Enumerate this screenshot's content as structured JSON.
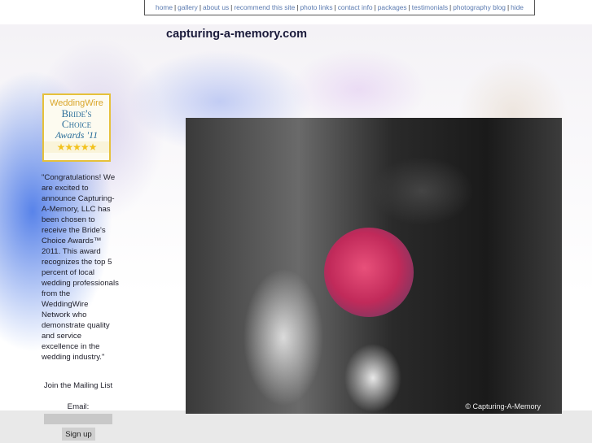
{
  "nav": {
    "items": [
      "home",
      "gallery",
      "about us",
      "recommend this site",
      "photo links",
      "contact info",
      "packages",
      "testimonials",
      "photography blog",
      "hide"
    ]
  },
  "site_title": "capturing-a-memory.com",
  "badge": {
    "brand": "WeddingWire",
    "line1": "Bride's",
    "line2": "Choice",
    "line3": "Awards '11",
    "stars": 5
  },
  "sidebar": {
    "quote": "\"Congratulations! We are excited to announce Capturing-A-Memory, LLC has been chosen to receive the Bride's Choice Awards™ 2011. This award recognizes the top 5 percent of local wedding professionals from the WeddingWire Network who demonstrate quality and service excellence in the wedding industry.\"",
    "mailing_list": "Join the Mailing List",
    "email_label": "Email:",
    "email_value": "",
    "signup_label": "Sign up"
  },
  "photo": {
    "watermark": "© Capturing-A-Memory"
  }
}
